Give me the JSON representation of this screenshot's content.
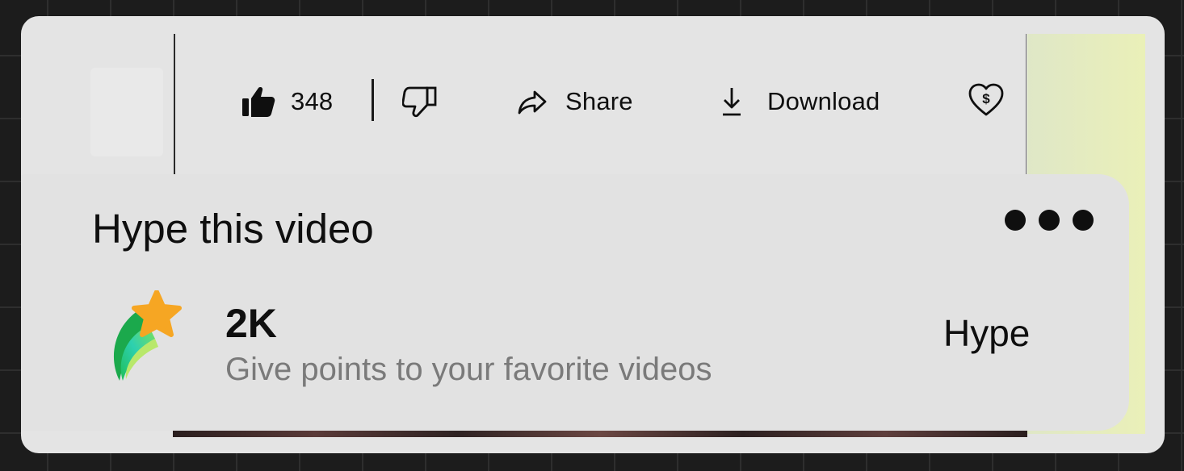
{
  "actions": {
    "like_count": "348",
    "share_label": "Share",
    "download_label": "Download"
  },
  "hype": {
    "title": "Hype this video",
    "count": "2K",
    "description": "Give points to your favorite videos",
    "button_label": "Hype"
  },
  "icons": {
    "like": "thumbs-up-icon",
    "dislike": "thumbs-down-icon",
    "share": "share-arrow-icon",
    "download": "download-icon",
    "thanks": "heart-dollar-icon",
    "more": "more-dots-icon",
    "hype": "shooting-star-icon"
  },
  "colors": {
    "card_bg": "#e4e4e4",
    "text_primary": "#0f0f0f",
    "text_secondary": "#7a7a7a",
    "star": "#f6a623"
  }
}
